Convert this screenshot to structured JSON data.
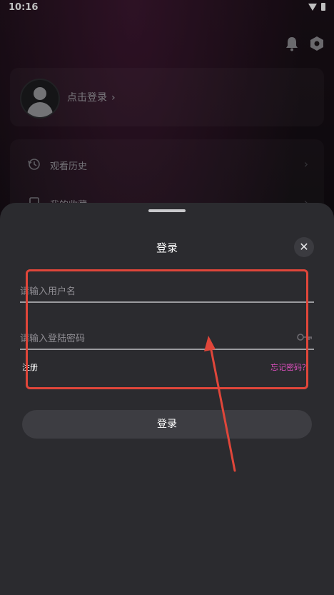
{
  "status_bar": {
    "time": "10:16"
  },
  "header": {
    "icons": [
      "bell-icon",
      "settings-icon"
    ]
  },
  "profile": {
    "login_prompt": "点击登录",
    "chevron": "›",
    "icon": "user-avatar-icon"
  },
  "menu": {
    "items": [
      {
        "label": "观看历史",
        "icon": "history-icon",
        "arrow": "›"
      },
      {
        "label": "我的收藏",
        "icon": "favorites-icon",
        "arrow": "›"
      }
    ]
  },
  "login_sheet": {
    "title": "登录",
    "close_glyph": "✕",
    "username_placeholder": "请输入用户名",
    "password_placeholder": "请输入登陆密码",
    "password_toggle_icon": "key-icon",
    "register_label": "注册",
    "forgot_label": "忘记密码？",
    "submit_label": "登录"
  },
  "colors": {
    "sheet_bg": "#2b2b2f",
    "accent_pink": "#e050c0",
    "annotation_red": "#e0463a"
  }
}
